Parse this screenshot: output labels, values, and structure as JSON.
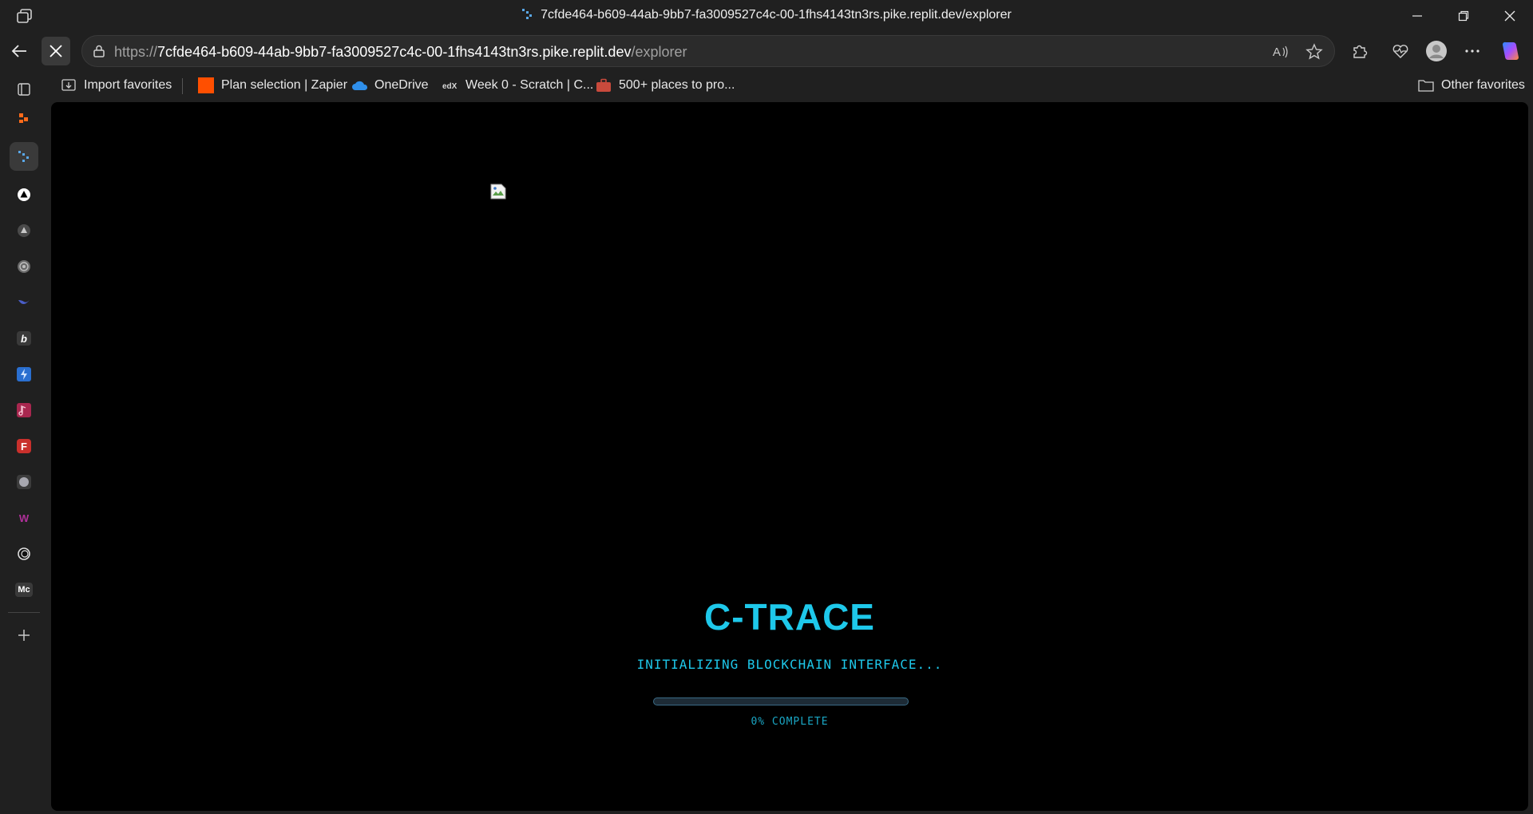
{
  "window": {
    "title": "7cfde464-b609-44ab-9bb7-fa3009527c4c-00-1fhs4143tn3rs.pike.replit.dev/explorer"
  },
  "address_bar": {
    "url_prefix": "https://",
    "url_host": "7cfde464-b609-44ab-9bb7-fa3009527c4c-00-1fhs4143tn3rs.pike.replit.dev",
    "url_path": "/explorer"
  },
  "favorites": {
    "items": [
      {
        "label": "Import favorites",
        "icon": "import-icon"
      },
      {
        "label": "Plan selection | Zapier",
        "icon": "zapier-icon"
      },
      {
        "label": "OneDrive",
        "icon": "onedrive-cloud-icon"
      },
      {
        "label": "Week 0 - Scratch | C...",
        "icon": "edx-icon"
      },
      {
        "label": "500+ places to pro...",
        "icon": "briefcase-icon"
      }
    ],
    "other_label": "Other favorites"
  },
  "sidebar": {
    "items": [
      {
        "icon": "tab-actions-icon"
      },
      {
        "icon": "zapier-app-icon"
      },
      {
        "icon": "replit-icon"
      },
      {
        "icon": "triangle-circle-icon"
      },
      {
        "icon": "triangle-gray-icon"
      },
      {
        "icon": "spiral-icon"
      },
      {
        "icon": "bird-icon"
      },
      {
        "icon": "b-letter-icon",
        "letter": "b"
      },
      {
        "icon": "bolt-icon"
      },
      {
        "icon": "music-note-icon"
      },
      {
        "icon": "f-letter-icon",
        "letter": "F"
      },
      {
        "icon": "circle-gray-icon"
      },
      {
        "icon": "w-letter-icon",
        "letter": "W"
      },
      {
        "icon": "ring-icon"
      },
      {
        "icon": "mc-letter-icon",
        "letter": "Mc"
      },
      {
        "icon": "add-icon"
      }
    ]
  },
  "page": {
    "app_title": "C-TRACE",
    "status": "INITIALIZING BLOCKCHAIN INTERFACE...",
    "progress_percent": 0,
    "progress_text": "0% COMPLETE"
  },
  "colors": {
    "accent": "#1ec8ea",
    "background": "#000000",
    "chrome": "#202020"
  }
}
